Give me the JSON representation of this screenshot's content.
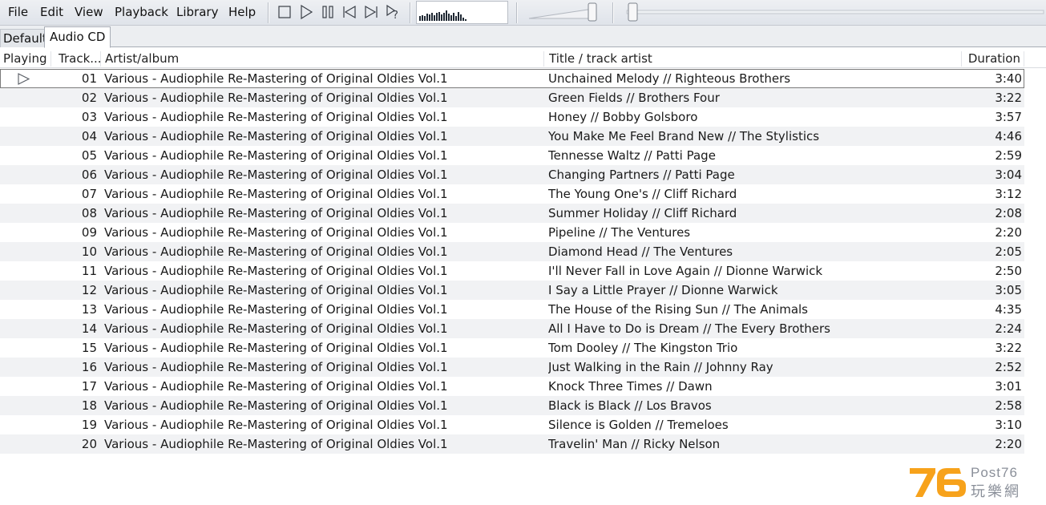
{
  "menu": [
    "File",
    "Edit",
    "View",
    "Playback",
    "Library",
    "Help"
  ],
  "toolbar": {
    "buttons": [
      "stop-icon",
      "play-icon",
      "pause-icon",
      "previous-icon",
      "next-icon",
      "random-icon"
    ]
  },
  "visualizer": {
    "levels": [
      0.35,
      0.45,
      0.4,
      0.55,
      0.5,
      0.6,
      0.45,
      0.65,
      0.7,
      0.5,
      0.6,
      0.8,
      0.55,
      0.45,
      0.6,
      0.4,
      0.7,
      0.5,
      0.25,
      0.1
    ]
  },
  "volume": {
    "level": 1.0
  },
  "seek": {
    "position": 0.0
  },
  "tabs": [
    "Default",
    "Audio CD"
  ],
  "columns": {
    "playing": "Playing",
    "track": "Track...",
    "artist": "Artist/album",
    "title": "Title / track artist",
    "duration": "Duration"
  },
  "tracks": [
    {
      "track": "01",
      "artist": "Various - Audiophile Re-Mastering of Original Oldies Vol.1",
      "title": "Unchained Melody // Righteous Brothers",
      "duration": "3:40",
      "playing": true
    },
    {
      "track": "02",
      "artist": "Various - Audiophile Re-Mastering of Original Oldies Vol.1",
      "title": "Green Fields // Brothers Four",
      "duration": "3:22"
    },
    {
      "track": "03",
      "artist": "Various - Audiophile Re-Mastering of Original Oldies Vol.1",
      "title": "Honey // Bobby Golsboro",
      "duration": "3:57"
    },
    {
      "track": "04",
      "artist": "Various - Audiophile Re-Mastering of Original Oldies Vol.1",
      "title": "You Make Me Feel Brand New // The Stylistics",
      "duration": "4:46"
    },
    {
      "track": "05",
      "artist": "Various - Audiophile Re-Mastering of Original Oldies Vol.1",
      "title": "Tennesse Waltz // Patti Page",
      "duration": "2:59"
    },
    {
      "track": "06",
      "artist": "Various - Audiophile Re-Mastering of Original Oldies Vol.1",
      "title": "Changing Partners // Patti Page",
      "duration": "3:04"
    },
    {
      "track": "07",
      "artist": "Various - Audiophile Re-Mastering of Original Oldies Vol.1",
      "title": "The Young One's // Cliff Richard",
      "duration": "3:12"
    },
    {
      "track": "08",
      "artist": "Various - Audiophile Re-Mastering of Original Oldies Vol.1",
      "title": "Summer Holiday // Cliff Richard",
      "duration": "2:08"
    },
    {
      "track": "09",
      "artist": "Various - Audiophile Re-Mastering of Original Oldies Vol.1",
      "title": "Pipeline // The Ventures",
      "duration": "2:20"
    },
    {
      "track": "10",
      "artist": "Various - Audiophile Re-Mastering of Original Oldies Vol.1",
      "title": "Diamond Head // The Ventures",
      "duration": "2:05"
    },
    {
      "track": "11",
      "artist": "Various - Audiophile Re-Mastering of Original Oldies Vol.1",
      "title": "I'll Never Fall in Love Again // Dionne Warwick",
      "duration": "2:50"
    },
    {
      "track": "12",
      "artist": "Various - Audiophile Re-Mastering of Original Oldies Vol.1",
      "title": "I Say a Little Prayer // Dionne Warwick",
      "duration": "3:05"
    },
    {
      "track": "13",
      "artist": "Various - Audiophile Re-Mastering of Original Oldies Vol.1",
      "title": "The House of the Rising Sun // The Animals",
      "duration": "4:35"
    },
    {
      "track": "14",
      "artist": "Various - Audiophile Re-Mastering of Original Oldies Vol.1",
      "title": "All I Have to Do is Dream // The Every Brothers",
      "duration": "2:24"
    },
    {
      "track": "15",
      "artist": "Various - Audiophile Re-Mastering of Original Oldies Vol.1",
      "title": "Tom Dooley // The Kingston Trio",
      "duration": "3:22"
    },
    {
      "track": "16",
      "artist": "Various - Audiophile Re-Mastering of Original Oldies Vol.1",
      "title": "Just Walking in the Rain // Johnny Ray",
      "duration": "2:52"
    },
    {
      "track": "17",
      "artist": "Various - Audiophile Re-Mastering of Original Oldies Vol.1",
      "title": "Knock Three Times // Dawn",
      "duration": "3:01"
    },
    {
      "track": "18",
      "artist": "Various - Audiophile Re-Mastering of Original Oldies Vol.1",
      "title": "Black is Black // Los Bravos",
      "duration": "2:58"
    },
    {
      "track": "19",
      "artist": "Various - Audiophile Re-Mastering of Original Oldies Vol.1",
      "title": "Silence is Golden // Tremeloes",
      "duration": "3:10"
    },
    {
      "track": "20",
      "artist": "Various - Audiophile Re-Mastering of Original Oldies Vol.1",
      "title": "Travelin' Man // Ricky Nelson",
      "duration": "2:20"
    }
  ],
  "watermark": {
    "digits": "76",
    "brand_latin": "Post76",
    "brand_cjk": "玩樂網",
    "color_digits": "#f7a21b",
    "color_text": "#8a8f99"
  },
  "colors": {
    "alt_row": "#f1f2f4",
    "toolbar_bg": "#e3e6ec"
  }
}
